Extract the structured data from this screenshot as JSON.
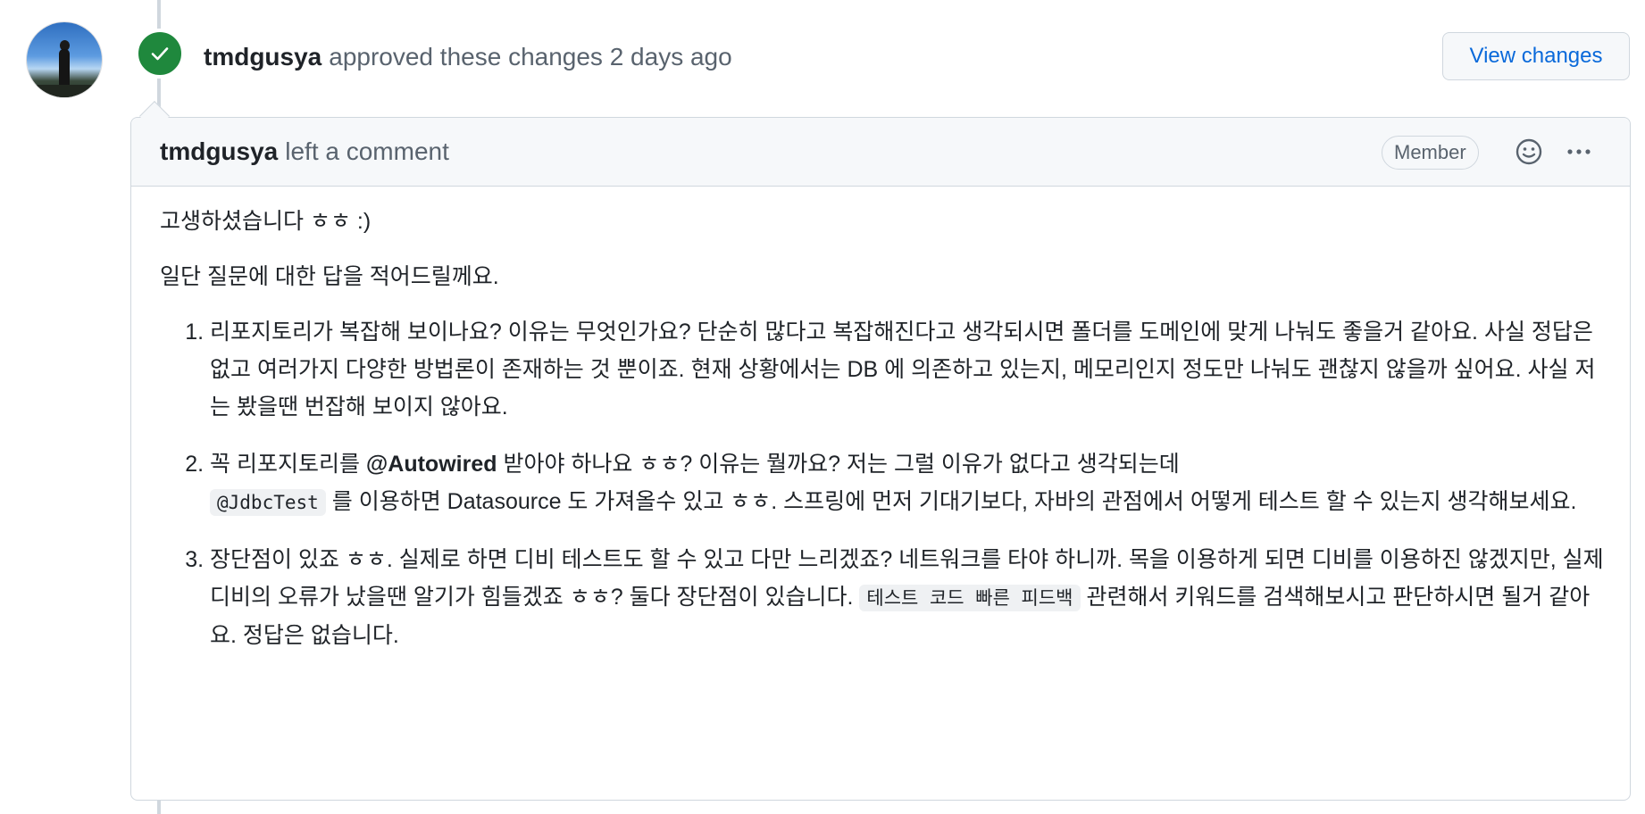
{
  "review": {
    "author": "tmdgusya",
    "action_text": "approved these changes 2 days ago",
    "view_changes_label": "View changes",
    "status_color": "#1f883d"
  },
  "comment": {
    "author": "tmdgusya",
    "action_text": "left a comment",
    "role_badge": "Member",
    "icons": [
      "smiley-icon",
      "kebab-horizontal-icon"
    ],
    "paragraph_1": "고생하셨습니다 ㅎㅎ :)",
    "paragraph_2": "일단 질문에 대한 답을 적어드릴께요.",
    "items": [
      {
        "number": "1.",
        "text": "리포지토리가 복잡해 보이나요? 이유는 무엇인가요? 단순히 많다고 복잡해진다고 생각되시면 폴더를 도메인에 맞게 나눠도 좋을거 같아요. 사실 정답은 없고 여러가지 다양한 방법론이 존재하는 것 뿐이죠. 현재 상황에서는 DB 에 의존하고 있는지, 메모리인지 정도만 나눠도 괜찮지 않을까 싶어요. 사실 저는 봤을땐 번잡해 보이지 않아요."
      },
      {
        "number": "2.",
        "text_before": "꼭 리포지토리를 ",
        "mention": "@Autowired",
        "text_mid": " 받아야 하나요 ㅎㅎ? 이유는 뭘까요? 저는 그럴 이유가 없다고 생각되는데",
        "code": "@JdbcTest",
        "text_after": " 를 이용하면 Datasource 도 가져올수 있고 ㅎㅎ. 스프링에 먼저 기대기보다, 자바의 관점에서 어떻게 테스트 할 수 있는지 생각해보세요."
      },
      {
        "number": "3.",
        "text_before": "장단점이 있죠 ㅎㅎ. 실제로 하면 디비 테스트도 할 수 있고 다만 느리겠죠? 네트워크를 타야 하니까. 목을 이용하게 되면 디비를 이용하진 않겠지만, 실제 디비의 오류가 났을땐 알기가 힘들겠죠 ㅎㅎ? 둘다 장단점이 있습니다. ",
        "code": "테스트 코드 빠른 피드백",
        "text_after": " 관련해서 키워드를 검색해보시고 판단하시면 될거 같아요. 정답은 없습니다."
      }
    ]
  }
}
